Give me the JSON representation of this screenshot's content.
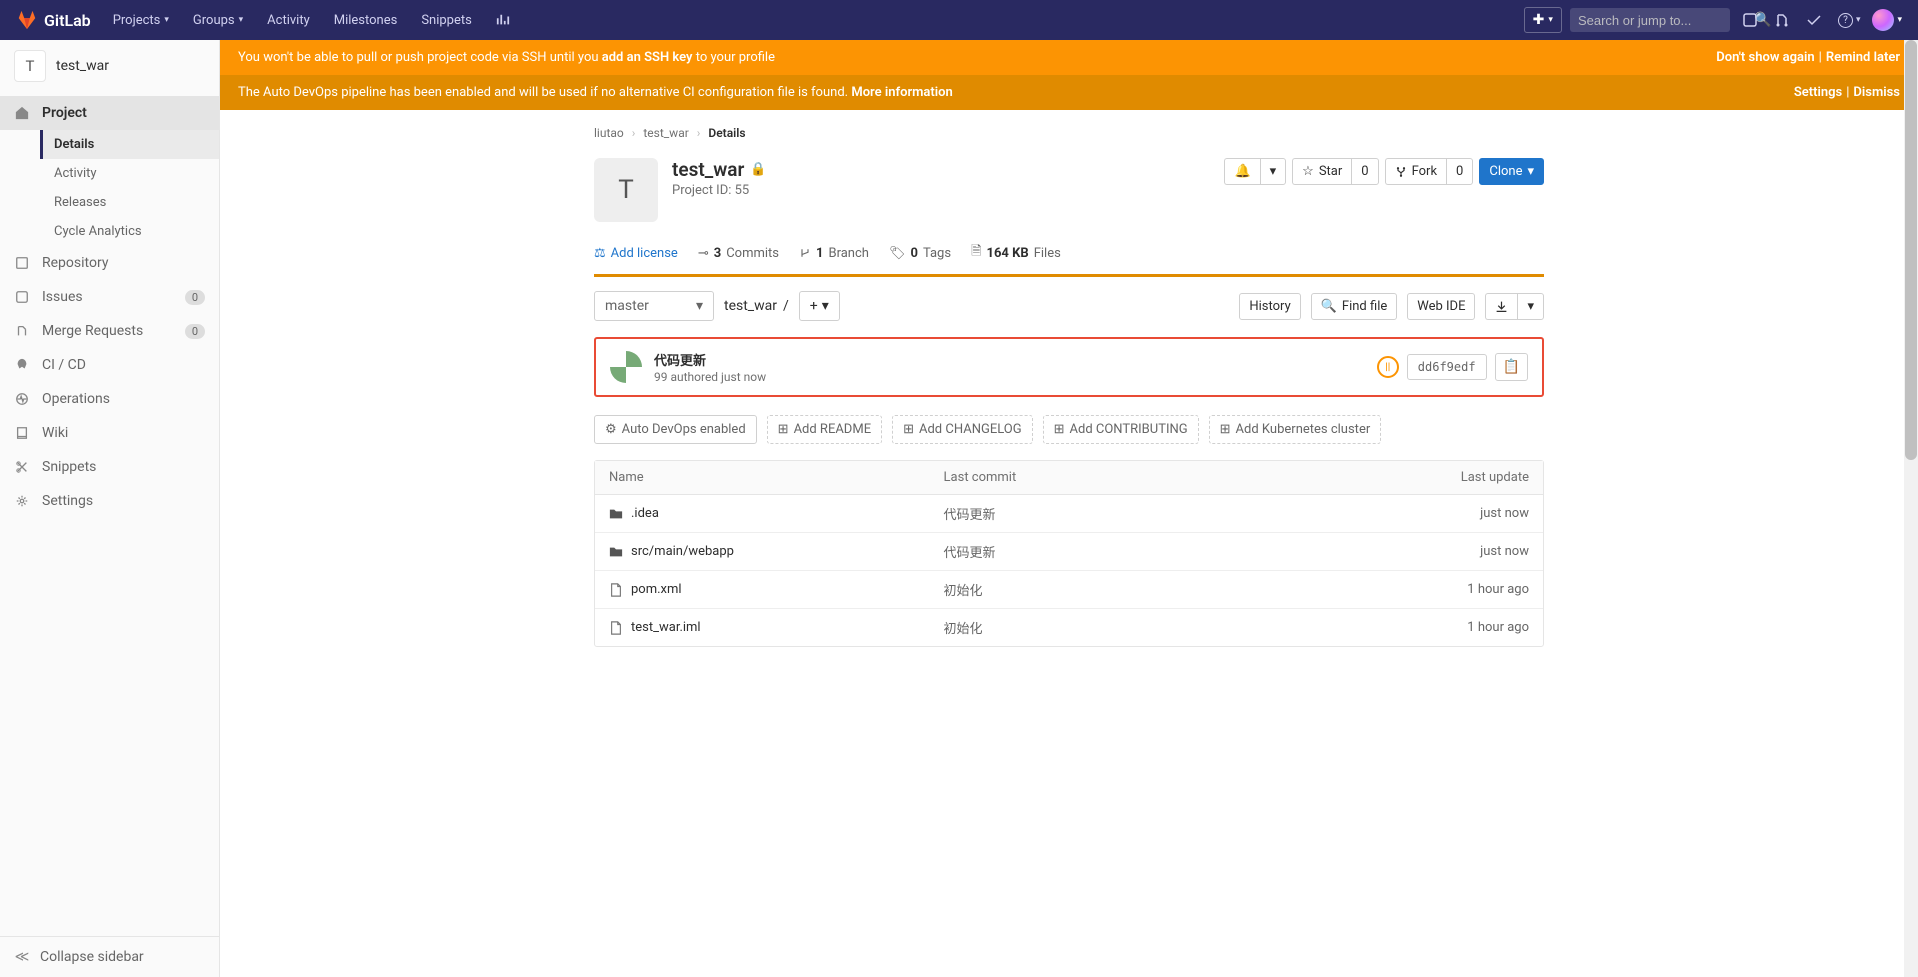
{
  "brand": "GitLab",
  "nav": {
    "projects": "Projects",
    "groups": "Groups",
    "activity": "Activity",
    "milestones": "Milestones",
    "snippets": "Snippets",
    "search_placeholder": "Search or jump to..."
  },
  "alerts": {
    "ssh_prefix": "You won't be able to pull or push project code via SSH until you ",
    "ssh_link": "add an SSH key",
    "ssh_suffix": " to your profile",
    "ssh_dont_show": "Don't show again",
    "ssh_remind": "Remind later",
    "devops_text": "The Auto DevOps pipeline has been enabled and will be used if no alternative CI configuration file is found. ",
    "devops_more": "More information",
    "devops_settings": "Settings",
    "devops_dismiss": "Dismiss"
  },
  "sidebar": {
    "project_name": "test_war",
    "project_letter": "T",
    "items": {
      "project": "Project",
      "details": "Details",
      "activity": "Activity",
      "releases": "Releases",
      "cycle": "Cycle Analytics",
      "repository": "Repository",
      "issues": "Issues",
      "issues_count": "0",
      "mr": "Merge Requests",
      "mr_count": "0",
      "cicd": "CI / CD",
      "operations": "Operations",
      "wiki": "Wiki",
      "snippets": "Snippets",
      "settings": "Settings"
    },
    "collapse": "Collapse sidebar"
  },
  "breadcrumb": {
    "owner": "liutao",
    "project": "test_war",
    "page": "Details"
  },
  "project": {
    "name": "test_war",
    "id_label": "Project ID: 55",
    "letter": "T",
    "notify": "",
    "star_label": "Star",
    "star_count": "0",
    "fork_label": "Fork",
    "fork_count": "0",
    "clone_label": "Clone"
  },
  "stats": {
    "add_license": "Add license",
    "commits_count": "3",
    "commits_label": " Commits",
    "branches_count": "1",
    "branches_label": " Branch",
    "tags_count": "0",
    "tags_label": " Tags",
    "size_count": "164 KB",
    "size_label": " Files"
  },
  "repo": {
    "branch": "master",
    "path": "test_war",
    "path_sep": "/",
    "history": "History",
    "find_file": "Find file",
    "web_ide": "Web IDE"
  },
  "commit": {
    "title": "代码更新",
    "meta": "99 authored just now",
    "sha": "dd6f9edf",
    "pipeline_status": "||"
  },
  "quick": {
    "auto_devops": "Auto DevOps enabled",
    "readme": "Add README",
    "changelog": "Add CHANGELOG",
    "contributing": "Add CONTRIBUTING",
    "kubernetes": "Add Kubernetes cluster"
  },
  "table": {
    "col_name": "Name",
    "col_commit": "Last commit",
    "col_update": "Last update",
    "rows": [
      {
        "name": ".idea",
        "type": "folder",
        "commit": "代码更新",
        "update": "just now"
      },
      {
        "name": "src/main/webapp",
        "type": "folder",
        "commit": "代码更新",
        "update": "just now"
      },
      {
        "name": "pom.xml",
        "type": "file",
        "commit": "初始化",
        "update": "1 hour ago"
      },
      {
        "name": "test_war.iml",
        "type": "file",
        "commit": "初始化",
        "update": "1 hour ago"
      }
    ]
  }
}
